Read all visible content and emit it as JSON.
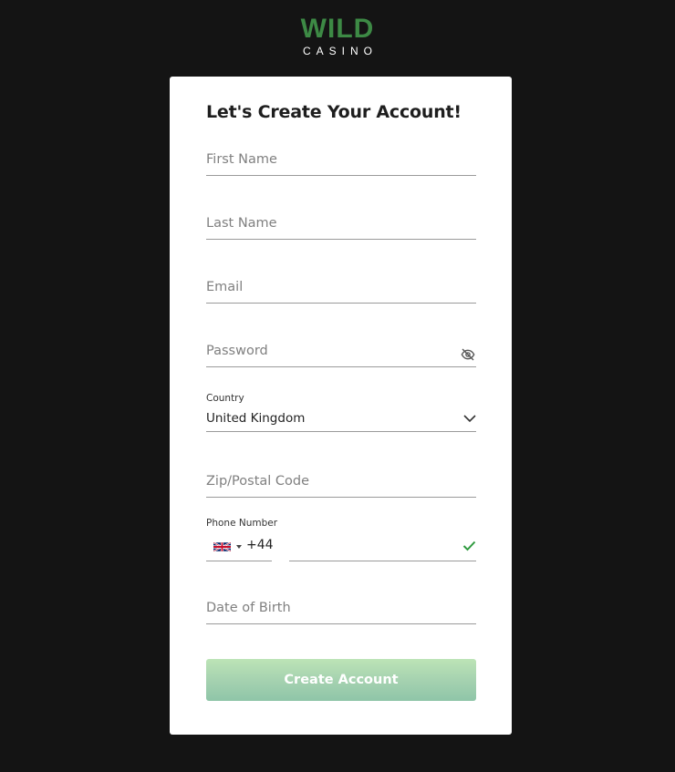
{
  "logo": {
    "brand_top": "WILD",
    "brand_bottom": "CASINO",
    "brand_color": "#3d8a45"
  },
  "form": {
    "title": "Let's Create Your Account!",
    "first_name": {
      "placeholder": "First Name",
      "value": ""
    },
    "last_name": {
      "placeholder": "Last Name",
      "value": ""
    },
    "email": {
      "placeholder": "Email",
      "value": ""
    },
    "password": {
      "placeholder": "Password",
      "value": "",
      "toggle_icon": "eye-slash-icon"
    },
    "country": {
      "label": "Country",
      "value": "United Kingdom",
      "icon": "chevron-down-icon"
    },
    "zip": {
      "placeholder": "Zip/Postal Code",
      "value": ""
    },
    "phone": {
      "label": "Phone Number",
      "flag_icon": "uk-flag-icon",
      "dial_code": "+44",
      "value": "",
      "valid_icon": "checkmark-icon",
      "valid_color": "#2e9a3e"
    },
    "dob": {
      "placeholder": "Date of Birth",
      "value": ""
    },
    "submit_label": "Create Account"
  }
}
